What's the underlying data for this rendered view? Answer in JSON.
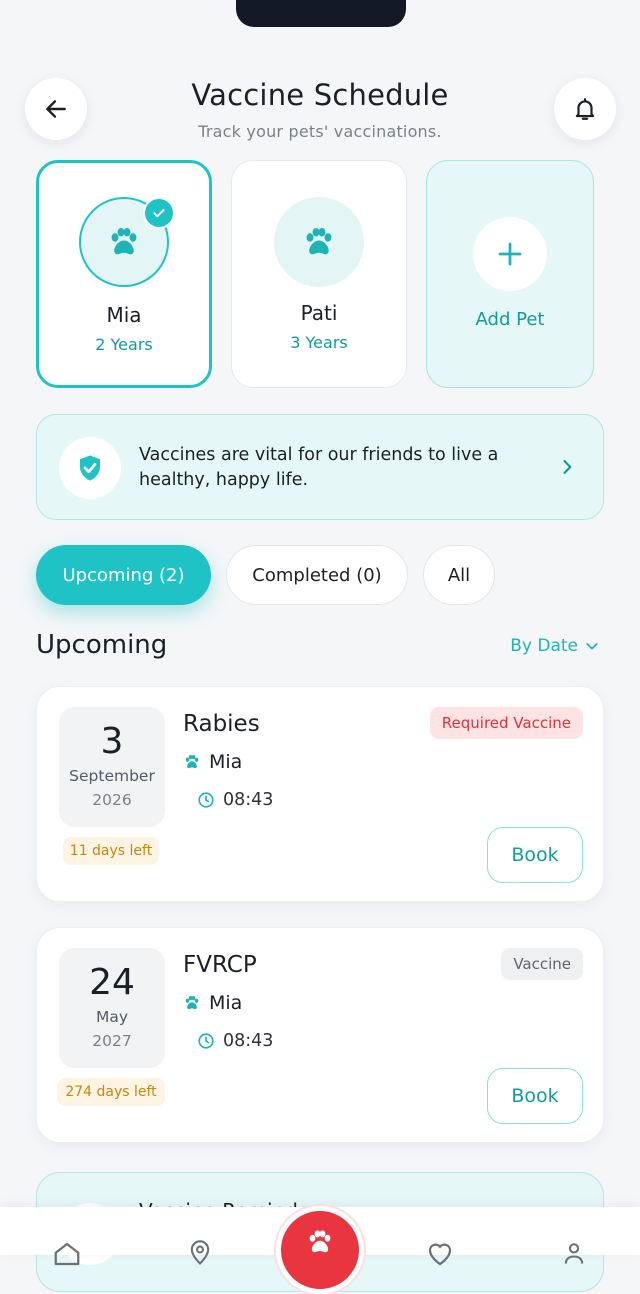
{
  "header": {
    "title": "Vaccine Schedule",
    "subtitle": "Track your pets' vaccinations.",
    "back_icon": "arrow-left-icon",
    "bell_icon": "bell-icon"
  },
  "pets": [
    {
      "name": "Mia",
      "age": "2 Years",
      "selected": true
    },
    {
      "name": "Pati",
      "age": "3 Years",
      "selected": false
    }
  ],
  "add_pet_label": "Add Pet",
  "info_banner": {
    "text": "Vaccines are vital for our friends to live a healthy, happy life.",
    "icon": "shield-check-icon"
  },
  "filters": {
    "upcoming": "Upcoming (2)",
    "completed": "Completed (0)",
    "all": "All",
    "active": "upcoming"
  },
  "section": {
    "title": "Upcoming",
    "sort_label": "By Date"
  },
  "vaccines": [
    {
      "day": "3",
      "month": "September",
      "year": "2026",
      "days_left": "11 days left",
      "name": "Rabies",
      "pet": "Mia",
      "time": "08:43",
      "badge": "Required Vaccine",
      "badge_type": "required",
      "book_label": "Book"
    },
    {
      "day": "24",
      "month": "May",
      "year": "2027",
      "days_left": "274 days left",
      "name": "FVRCP",
      "pet": "Mia",
      "time": "08:43",
      "badge": "Vaccine",
      "badge_type": "normal",
      "book_label": "Book"
    }
  ],
  "reminder": {
    "title": "Vaccine Reminders"
  },
  "colors": {
    "accent": "#1fc3c6",
    "accent_dark": "#139a9c",
    "required_red": "#e0313c",
    "nav_center": "#e8353f",
    "warning": "#c9860a"
  }
}
